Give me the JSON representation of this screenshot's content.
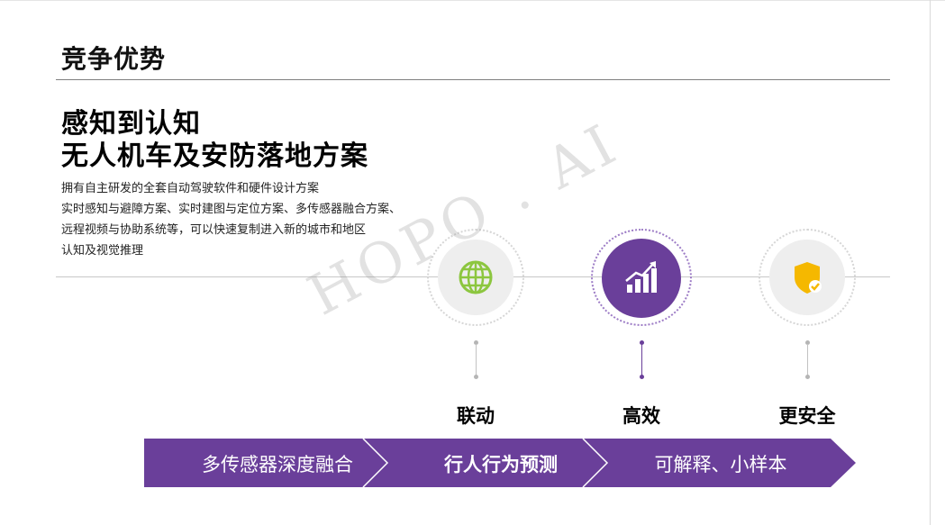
{
  "header": {
    "title": "竞争优势"
  },
  "headline": {
    "line1": "感知到认知",
    "line2": "无人机车及安防落地方案"
  },
  "description": [
    "拥有自主研发的全套自动驾驶软件和硬件设计方案",
    "实时感知与避障方案、实时建图与定位方案、多传感器融合方案、",
    "远程视频与协助系统等，可以快速复制进入新的城市和地区",
    "认知及视觉推理"
  ],
  "watermark": "HOPO . AI",
  "features": [
    {
      "label": "联动",
      "icon": "globe-icon"
    },
    {
      "label": "高效",
      "icon": "bar-chart-growth-icon"
    },
    {
      "label": "更安全",
      "icon": "shield-check-icon"
    }
  ],
  "ribbon": {
    "segments": [
      "多传感器深度融合",
      "行人行为预测",
      "可解释、小样本"
    ]
  },
  "colors": {
    "purple": "#6a3f9a",
    "globe_green": "#8cc63f",
    "shield_yellow": "#f5b800"
  }
}
